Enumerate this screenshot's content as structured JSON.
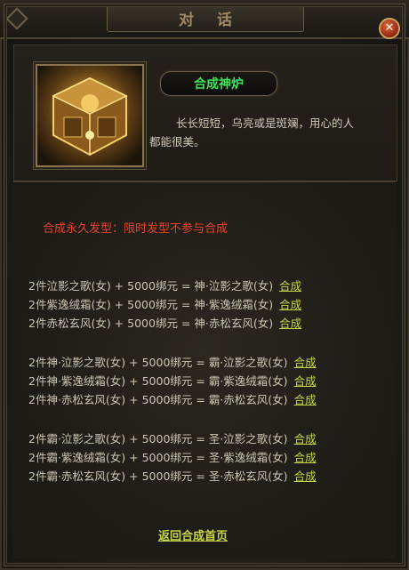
{
  "window": {
    "title": "对 话",
    "close_icon": "close-icon"
  },
  "npc": {
    "name": "合成神炉",
    "description": "长长短短，乌亮或是斑斓，用心的人都能很美。",
    "portrait_icon": "treasure-furnace-icon"
  },
  "notice": "合成永久发型：限时发型不参与合成",
  "groups": [
    {
      "recipes": [
        {
          "text": "2件泣影之歌(女) + 5000绑元 = 神·泣影之歌(女)",
          "action": "合成"
        },
        {
          "text": "2件紫逸绒霜(女) + 5000绑元 = 神·紫逸绒霜(女)",
          "action": "合成"
        },
        {
          "text": "2件赤松玄风(女) + 5000绑元 = 神·赤松玄风(女)",
          "action": "合成"
        }
      ]
    },
    {
      "recipes": [
        {
          "text": "2件神·泣影之歌(女) + 5000绑元 = 霸·泣影之歌(女)",
          "action": "合成"
        },
        {
          "text": "2件神·紫逸绒霜(女) + 5000绑元 = 霸·紫逸绒霜(女)",
          "action": "合成"
        },
        {
          "text": "2件神·赤松玄风(女) + 5000绑元 = 霸·赤松玄风(女)",
          "action": "合成"
        }
      ]
    },
    {
      "recipes": [
        {
          "text": "2件霸·泣影之歌(女) + 5000绑元 = 圣·泣影之歌(女)",
          "action": "合成"
        },
        {
          "text": "2件霸·紫逸绒霜(女) + 5000绑元 = 圣·紫逸绒霜(女)",
          "action": "合成"
        },
        {
          "text": "2件霸·赤松玄风(女) + 5000绑元 = 圣·赤松玄风(女)",
          "action": "合成"
        }
      ]
    }
  ],
  "footer": {
    "back_label": "返回合成首页"
  },
  "colors": {
    "npc_name": "#3ee05a",
    "notice": "#e8422c",
    "link": "#c8d44a",
    "text": "#cdc6b4"
  }
}
